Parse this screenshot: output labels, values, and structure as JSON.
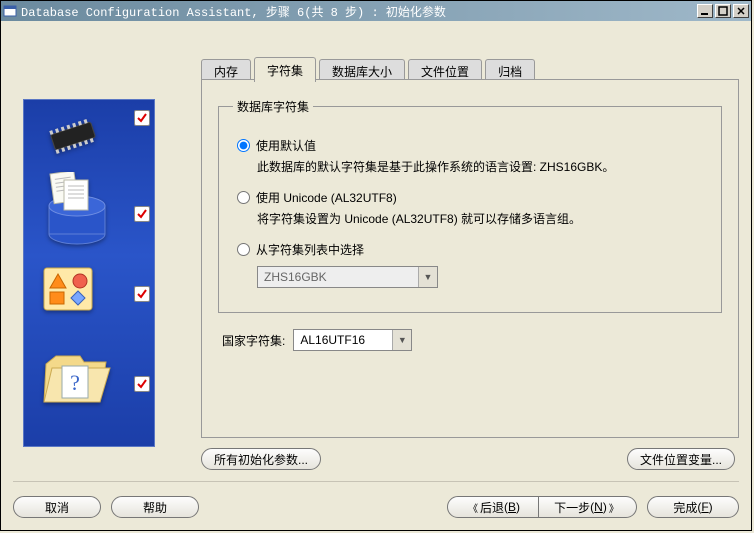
{
  "window": {
    "title": "Database Configuration Assistant, 步骤 6(共 8 步) : 初始化参数"
  },
  "tabs": {
    "memory": "内存",
    "charset": "字符集",
    "dbsize": "数据库大小",
    "filelocation": "文件位置",
    "archive": "归档",
    "active": "charset"
  },
  "group_title": "数据库字符集",
  "radios": {
    "default": {
      "label": "使用默认值",
      "desc": "此数据库的默认字符集是基于此操作系统的语言设置: ZHS16GBK。"
    },
    "unicode": {
      "label": "使用 Unicode (AL32UTF8)",
      "desc": "将字符集设置为 Unicode (AL32UTF8) 就可以存储多语言组。"
    },
    "list": {
      "label": "从字符集列表中选择"
    },
    "selected": "default"
  },
  "charset_dropdown": {
    "value": "ZHS16GBK",
    "enabled": false
  },
  "national_charset": {
    "label": "国家字符集:",
    "value": "AL16UTF16",
    "enabled": true
  },
  "buttons": {
    "all_params": "所有初始化参数...",
    "file_vars": "文件位置变量...",
    "cancel": "取消",
    "help": "帮助",
    "back_text": "后退",
    "back_accel": "B",
    "next_text": "下一步",
    "next_accel": "N",
    "finish_text": "完成",
    "finish_accel": "F"
  }
}
